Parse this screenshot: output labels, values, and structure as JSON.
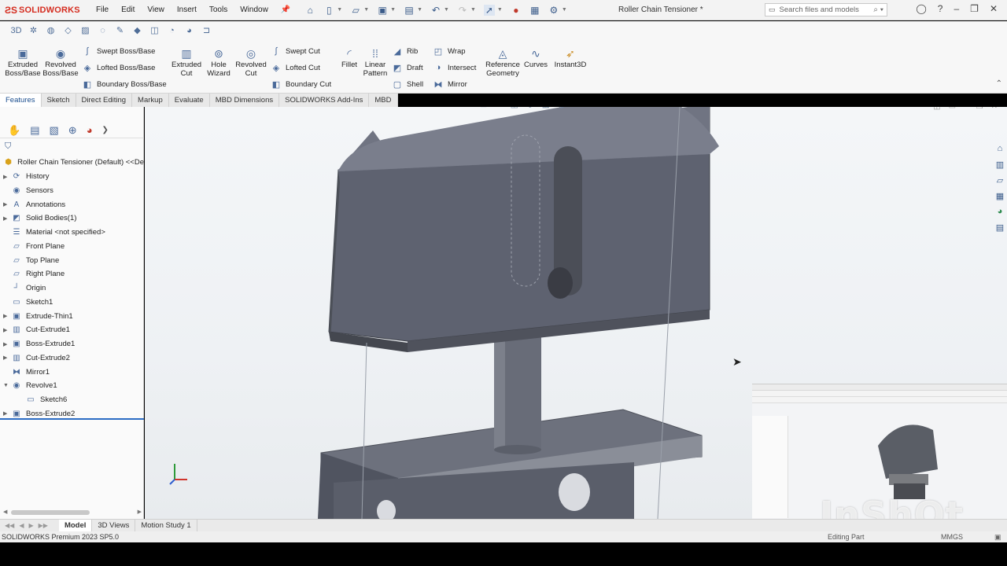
{
  "app": {
    "brand": "SOLIDWORKS",
    "document_title": "Roller Chain Tensioner *",
    "version": "SOLIDWORKS Premium 2023 SP5.0"
  },
  "menu": [
    "File",
    "Edit",
    "View",
    "Insert",
    "Tools",
    "Window"
  ],
  "search": {
    "placeholder": "Search files and models"
  },
  "ribbon": {
    "big_tools": [
      {
        "label": "Extruded Boss/Base"
      },
      {
        "label": "Revolved Boss/Base"
      },
      {
        "label": "Extruded Cut"
      },
      {
        "label": "Hole Wizard"
      },
      {
        "label": "Revolved Cut"
      },
      {
        "label": "Fillet"
      },
      {
        "label": "Linear Pattern"
      },
      {
        "label": "Reference Geometry"
      },
      {
        "label": "Curves"
      },
      {
        "label": "Instant3D"
      }
    ],
    "small_tools": [
      {
        "label": "Swept Boss/Base"
      },
      {
        "label": "Lofted Boss/Base"
      },
      {
        "label": "Boundary Boss/Base"
      },
      {
        "label": "Swept Cut"
      },
      {
        "label": "Lofted Cut"
      },
      {
        "label": "Boundary Cut"
      },
      {
        "label": "Rib"
      },
      {
        "label": "Draft"
      },
      {
        "label": "Shell"
      },
      {
        "label": "Wrap"
      },
      {
        "label": "Intersect"
      },
      {
        "label": "Mirror"
      }
    ]
  },
  "command_tabs": [
    "Features",
    "Sketch",
    "Direct Editing",
    "Markup",
    "Evaluate",
    "MBD Dimensions",
    "SOLIDWORKS Add-Ins",
    "MBD"
  ],
  "feature_tree": {
    "root": "Roller Chain Tensioner (Default) <<De",
    "items": [
      {
        "label": "History",
        "icon": "history-icon",
        "expandable": true
      },
      {
        "label": "Sensors",
        "icon": "sensor-icon",
        "expandable": false
      },
      {
        "label": "Annotations",
        "icon": "annotation-icon",
        "expandable": true
      },
      {
        "label": "Solid Bodies(1)",
        "icon": "solid-bodies-icon",
        "expandable": true
      },
      {
        "label": "Material <not specified>",
        "icon": "material-icon",
        "expandable": false
      },
      {
        "label": "Front Plane",
        "icon": "plane-icon",
        "expandable": false
      },
      {
        "label": "Top Plane",
        "icon": "plane-icon",
        "expandable": false
      },
      {
        "label": "Right Plane",
        "icon": "plane-icon",
        "expandable": false
      },
      {
        "label": "Origin",
        "icon": "origin-icon",
        "expandable": false
      },
      {
        "label": "Sketch1",
        "icon": "sketch-icon",
        "expandable": false
      },
      {
        "label": "Extrude-Thin1",
        "icon": "extrude-icon",
        "expandable": true
      },
      {
        "label": "Cut-Extrude1",
        "icon": "cut-icon",
        "expandable": true
      },
      {
        "label": "Boss-Extrude1",
        "icon": "extrude-icon",
        "expandable": true
      },
      {
        "label": "Cut-Extrude2",
        "icon": "cut-icon",
        "expandable": true
      },
      {
        "label": "Mirror1",
        "icon": "mirror-icon",
        "expandable": false
      },
      {
        "label": "Revolve1",
        "icon": "revolve-icon",
        "expandable": true,
        "expanded": true
      },
      {
        "label": "Sketch6",
        "icon": "sketch-icon",
        "expandable": false,
        "child": true
      },
      {
        "label": "Boss-Extrude2",
        "icon": "extrude-icon",
        "expandable": true
      }
    ]
  },
  "bottom_tabs": [
    "Model",
    "3D Views",
    "Motion Study 1"
  ],
  "status": {
    "right_text": "Editing Part",
    "units": "MMGS"
  },
  "watermark": "InShOt",
  "colors": {
    "brand_red": "#d52b1e",
    "model_gray": "#5f6370",
    "selection_blue": "#2b6cc4"
  }
}
